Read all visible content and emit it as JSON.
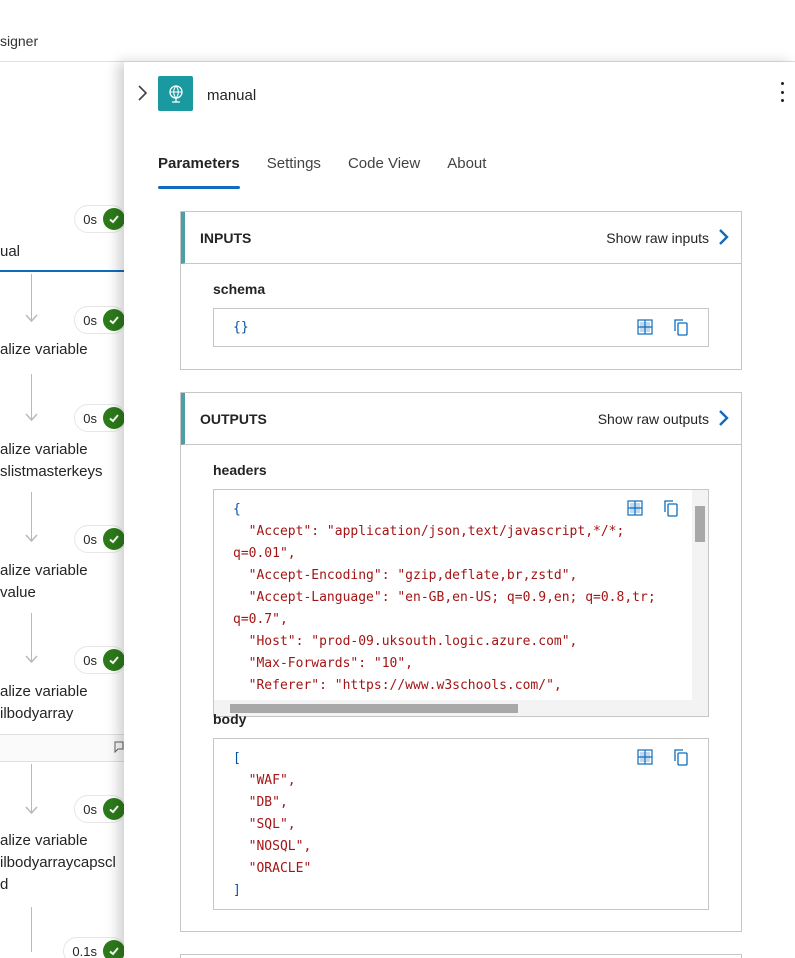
{
  "topbar": {
    "title": "signer"
  },
  "canvas": {
    "nodes": [
      {
        "line1": "ual",
        "line2": "",
        "duration": "0s"
      },
      {
        "line1": "alize variable",
        "line2": "",
        "duration": "0s"
      },
      {
        "line1": "alize variable",
        "line2": "slistmasterkeys",
        "duration": "0s"
      },
      {
        "line1": "alize variable",
        "line2": "value",
        "duration": "0s"
      },
      {
        "line1": "alize variable",
        "line2": "ilbodyarray",
        "duration": "0s"
      },
      {
        "line1": "alize variable",
        "line2": "ilbodyarraycapscl",
        "line3": "d",
        "duration": "0s"
      },
      {
        "duration": "0.1s"
      }
    ]
  },
  "panel": {
    "title": "manual",
    "tabs": [
      "Parameters",
      "Settings",
      "Code View",
      "About"
    ],
    "inputs": {
      "heading": "INPUTS",
      "raw_label": "Show raw inputs",
      "field_label": "schema",
      "code": [
        "{}"
      ]
    },
    "outputs": {
      "heading": "OUTPUTS",
      "raw_label": "Show raw outputs",
      "headers_label": "headers",
      "headers_lines": [
        "{",
        "  \"Accept\": \"application/json,text/javascript,*/*;",
        "q=0.01\",",
        "  \"Accept-Encoding\": \"gzip,deflate,br,zstd\",",
        "  \"Accept-Language\": \"en-GB,en-US; q=0.9,en; q=0.8,tr;",
        "q=0.7\",",
        "  \"Host\": \"prod-09.uksouth.logic.azure.com\",",
        "  \"Max-Forwards\": \"10\",",
        "  \"Referer\": \"https://www.w3schools.com/\","
      ],
      "body_label": "body",
      "body_lines": [
        "[",
        "  \"WAF\",",
        "  \"DB\",",
        "  \"SQL\",",
        "  \"NOSQL\",",
        "  \"ORACLE\"",
        "]"
      ]
    }
  },
  "colors": {
    "accent": "#0f6cbd",
    "success": "#2c7b1b",
    "trigger": "#1a9aa0",
    "string": "#a31515",
    "punct": "#0451a5"
  }
}
